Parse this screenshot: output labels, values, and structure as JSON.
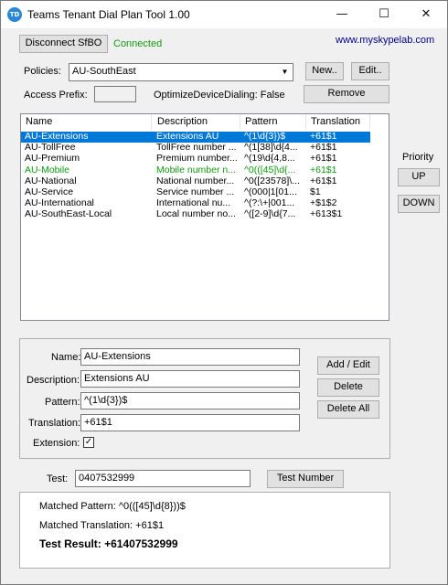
{
  "window": {
    "title": "Teams Tenant Dial Plan Tool 1.00",
    "minimize_glyph": "—",
    "maximize_glyph": "☐",
    "close_glyph": "✕",
    "icon_text": "TD"
  },
  "connection": {
    "disconnect_label": "Disconnect SfBO",
    "status": "Connected",
    "status_color": "#109a10",
    "website": "www.myskypelab.com"
  },
  "policies": {
    "label": "Policies:",
    "selected": "AU-SouthEast",
    "new_label": "New..",
    "edit_label": "Edit..",
    "remove_label": "Remove",
    "access_prefix_label": "Access Prefix:",
    "access_prefix_value": "",
    "optimize_text": "OptimizeDeviceDialing: False"
  },
  "rules_table": {
    "columns": [
      "Name",
      "Description",
      "Pattern",
      "Translation"
    ],
    "rows": [
      {
        "name": "AU-Extensions",
        "description": "Extensions AU",
        "pattern": "^(1\\d{3})$",
        "translation": "+61$1"
      },
      {
        "name": "AU-TollFree",
        "description": "TollFree number ...",
        "pattern": "^(1[38]\\d{4...",
        "translation": "+61$1"
      },
      {
        "name": "AU-Premium",
        "description": "Premium number...",
        "pattern": "^(19\\d{4,8...",
        "translation": "+61$1"
      },
      {
        "name": "AU-Mobile",
        "description": "Mobile number n...",
        "pattern": "^0(([45]\\d{...",
        "translation": "+61$1"
      },
      {
        "name": "AU-National",
        "description": "National number...",
        "pattern": "^0([23578]\\...",
        "translation": "+61$1"
      },
      {
        "name": "AU-Service",
        "description": "Service number ...",
        "pattern": "^(000|1[01...",
        "translation": "$1"
      },
      {
        "name": "AU-International",
        "description": "International nu...",
        "pattern": "^(?:\\+|001...",
        "translation": "+$1$2"
      },
      {
        "name": "AU-SouthEast-Local",
        "description": "Local number no...",
        "pattern": "^([2-9]\\d{7...",
        "translation": "+613$1"
      }
    ],
    "selected_color": "#0078d7",
    "highlight_color": "#109a10"
  },
  "priority": {
    "label": "Priority",
    "up_label": "UP",
    "down_label": "DOWN"
  },
  "rule_editor": {
    "name_label": "Name:",
    "name_value": "AU-Extensions",
    "description_label": "Description:",
    "description_value": "Extensions AU",
    "pattern_label": "Pattern:",
    "pattern_value": "^(1\\d{3})$",
    "translation_label": "Translation:",
    "translation_value": "+61$1",
    "extension_label": "Extension:",
    "extension_checked": "✓",
    "add_edit_label": "Add / Edit",
    "delete_label": "Delete",
    "delete_all_label": "Delete All"
  },
  "test": {
    "label": "Test:",
    "value": "0407532999",
    "button_label": "Test Number",
    "matched_pattern": "Matched Pattern: ^0(([45]\\d{8}))$",
    "matched_translation": "Matched Translation: +61$1",
    "result": "Test Result: +61407532999"
  }
}
